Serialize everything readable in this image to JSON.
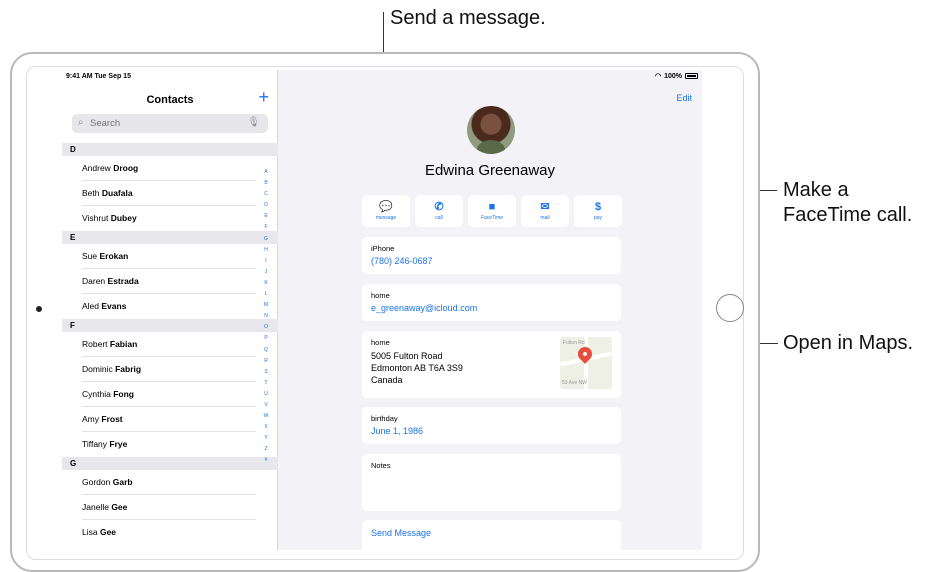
{
  "callouts": {
    "message": "Send a message.",
    "facetime_line1": "Make a",
    "facetime_line2": "FaceTime call.",
    "maps": "Open in Maps."
  },
  "status_bar": {
    "time": "9:41 AM  Tue Sep 15",
    "battery": "100%"
  },
  "sidebar": {
    "title": "Contacts",
    "add_label": "+",
    "search_placeholder": "Search",
    "sections": [
      {
        "letter": "D",
        "contacts": [
          {
            "first": "Andrew",
            "last": "Droog"
          },
          {
            "first": "Beth",
            "last": "Duafala"
          },
          {
            "first": "Vishrut",
            "last": "Dubey"
          }
        ]
      },
      {
        "letter": "E",
        "contacts": [
          {
            "first": "Sue",
            "last": "Erokan"
          },
          {
            "first": "Daren",
            "last": "Estrada"
          },
          {
            "first": "Aled",
            "last": "Evans"
          }
        ]
      },
      {
        "letter": "F",
        "contacts": [
          {
            "first": "Robert",
            "last": "Fabian"
          },
          {
            "first": "Dominic",
            "last": "Fabrig"
          },
          {
            "first": "Cynthia",
            "last": "Fong"
          },
          {
            "first": "Amy",
            "last": "Frost"
          },
          {
            "first": "Tiffany",
            "last": "Frye"
          }
        ]
      },
      {
        "letter": "G",
        "contacts": [
          {
            "first": "Gordon",
            "last": "Garb"
          },
          {
            "first": "Janelle",
            "last": "Gee"
          },
          {
            "first": "Lisa",
            "last": "Gee"
          }
        ]
      }
    ],
    "index_letters": [
      "A",
      "B",
      "C",
      "D",
      "E",
      "F",
      "G",
      "H",
      "I",
      "J",
      "K",
      "L",
      "M",
      "N",
      "O",
      "P",
      "Q",
      "R",
      "S",
      "T",
      "U",
      "V",
      "W",
      "X",
      "Y",
      "Z",
      "#"
    ]
  },
  "detail": {
    "edit_label": "Edit",
    "name": "Edwina Greenaway",
    "actions": [
      {
        "icon": "message-icon",
        "glyph": "💬",
        "label": "message"
      },
      {
        "icon": "phone-icon",
        "glyph": "✆",
        "label": "call"
      },
      {
        "icon": "video-icon",
        "glyph": "■",
        "label": "FaceTime"
      },
      {
        "icon": "mail-icon",
        "glyph": "✉",
        "label": "mail"
      },
      {
        "icon": "dollar-icon",
        "glyph": "$",
        "label": "pay"
      }
    ],
    "phone": {
      "label": "iPhone",
      "value": "(780) 246-0687"
    },
    "email": {
      "label": "home",
      "value": "e_greenaway@icloud.com"
    },
    "address": {
      "label": "home",
      "line1": "5005 Fulton Road",
      "line2": "Edmonton AB T6A 3S9",
      "line3": "Canada",
      "map_label_top": "Fulton Rd",
      "map_label_bottom": "53 Ave NW"
    },
    "birthday": {
      "label": "birthday",
      "value": "June 1, 1986"
    },
    "notes": {
      "label": "Notes"
    },
    "send_message": "Send Message"
  },
  "colors": {
    "accent": "#1a73e8",
    "map_pin": "#e94b3c"
  }
}
